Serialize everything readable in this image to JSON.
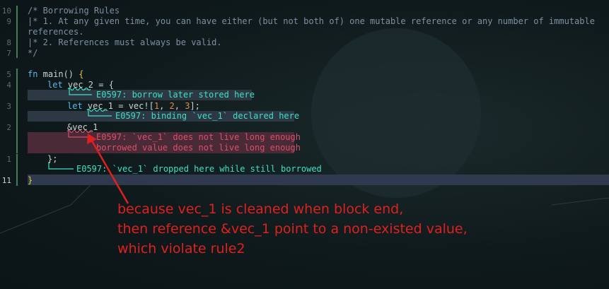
{
  "gutter": [
    "10",
    "9",
    "",
    "8",
    "7",
    "",
    "5",
    "4",
    "",
    "3",
    "",
    "2",
    "",
    "",
    "1",
    "",
    "11"
  ],
  "code": {
    "l1": "/* Borrowing Rules",
    "l2": "|* 1. At any given time, you can have either (but not both of) one mutable reference or any number of immutable",
    "l3": "references.",
    "l4": "|* 2. References must always be valid.",
    "l5": "*/",
    "fn_kw": "fn",
    "fn_name": " main() ",
    "open_brace": "{",
    "let1_kw": "let",
    "let1_rest": " vec_2 = {",
    "let2_kw": "let",
    "let2_a": " vec_1 = vec![",
    "n1": "1",
    "sep1": ", ",
    "n2": "2",
    "sep2": ", ",
    "n3": "3",
    "let2_end": "];",
    "ref": "&vec_1",
    "close_inner": "};",
    "close_outer": "}"
  },
  "diagnostics": {
    "d1": "E0597: borrow later stored here",
    "d2": "E0597: binding `vec_1` declared here",
    "d3a": "E0597: `vec_1` does not live long enough",
    "d3b": "borrowed value does not live long enough",
    "d4": "E0597: `vec_1` dropped here while still borrowed"
  },
  "annotation": {
    "line1": "because vec_1 is cleaned when block end,",
    "line2": "then reference &vec_1 point to a non-existed value,",
    "line3": "which violate rule2"
  },
  "colors": {
    "accent_red": "#e0201e",
    "diag_teal": "#3ee0c2",
    "diag_red": "#d7506a"
  }
}
